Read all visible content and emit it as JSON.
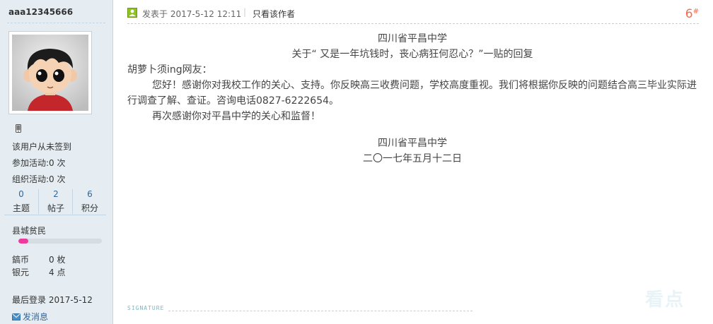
{
  "sidebar": {
    "username": "aaa12345666",
    "checkin_text": "该用户从未签到",
    "activity_join": "参加活动:0 次",
    "activity_org": "组织活动:0 次",
    "stats": [
      {
        "value": "0",
        "label": "主题"
      },
      {
        "value": "2",
        "label": "帖子"
      },
      {
        "value": "6",
        "label": "积分"
      }
    ],
    "group_name": "县城贫民",
    "group_progress": 0.12,
    "credits": [
      {
        "label": "鎬币",
        "value": "0 枚"
      },
      {
        "label": "银元",
        "value": "4 点"
      }
    ],
    "last_login": "最后登录 2017-5-12",
    "send_message": "发消息"
  },
  "post": {
    "posted_at": "发表于 2017-5-12 12:11",
    "separator": "|",
    "author_only": "只看该作者",
    "floor_number": "6",
    "floor_mark": "#",
    "title_line1": "四川省平昌中学",
    "title_line2": "关于“ 又是一年坑钱时，丧心病狂何忍心？”一贴的回复",
    "salutation": "胡萝卜须ing网友：",
    "paragraph1": "您好！感谢你对我校工作的关心、支持。你反映高三收费问题，学校高度重视。我们将根据你反映的问题结合高三毕业实际进行调查了解、查证。咨询电话0827-6222654。",
    "paragraph2": "再次感谢你对平昌中学的关心和监督！",
    "sign_org": "四川省平昌中学",
    "sign_date": "二〇一七年五月十二日"
  },
  "signature_label": "SIGNATURE",
  "colors": {
    "sidebar_bg": "#e5edf2",
    "floor_accent": "#f26c4f",
    "progress_fill": "#ee3a9a",
    "link": "#336699"
  }
}
